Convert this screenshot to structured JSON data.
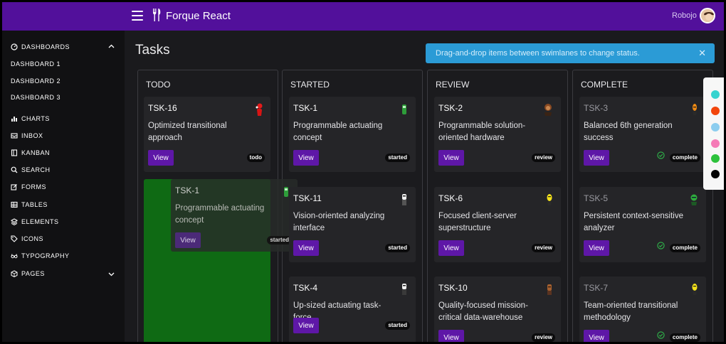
{
  "header": {
    "brand": "Forque React",
    "user": "Robojo"
  },
  "colors": {
    "primary": "#52109b",
    "button": "#5e17a7",
    "alert": "#2b9bd6",
    "drop_zone": "#0f6a14",
    "check": "#2fb84b"
  },
  "sidebar": {
    "dashboards": "DASHBOARDS",
    "dashboard_1": "DASHBOARD 1",
    "dashboard_2": "DASHBOARD 2",
    "dashboard_3": "DASHBOARD 3",
    "charts": "CHARTS",
    "inbox": "INBOX",
    "kanban": "KANBAN",
    "search": "SEARCH",
    "forms": "FORMS",
    "tables": "TABLES",
    "elements": "ELEMENTS",
    "icons": "ICONS",
    "typography": "TYPOGRAPHY",
    "pages": "PAGES"
  },
  "page": {
    "title": "Tasks",
    "alert": "Drag-and-drop items between swimlanes to change status."
  },
  "lanes": {
    "todo": "TODO",
    "started": "STARTED",
    "review": "REVIEW",
    "complete": "COMPLETE"
  },
  "button_label": "View",
  "cards": {
    "tsk16": {
      "id": "TSK-16",
      "desc": "Optimized transitional approach",
      "status": "todo"
    },
    "tsk1_ghost": {
      "id": "TSK-1",
      "desc": "Programmable actuating concept",
      "status": "started"
    },
    "tsk1": {
      "id": "TSK-1",
      "desc": "Programmable actuating concept",
      "status": "started"
    },
    "tsk11": {
      "id": "TSK-11",
      "desc": "Vision-oriented analyzing interface",
      "status": "started"
    },
    "tsk4": {
      "id": "TSK-4",
      "desc": "Up-sized actuating task-force",
      "status": "started"
    },
    "tsk2": {
      "id": "TSK-2",
      "desc": "Programmable solution-oriented hardware",
      "status": "review"
    },
    "tsk6": {
      "id": "TSK-6",
      "desc": "Focused client-server superstructure",
      "status": "review"
    },
    "tsk10": {
      "id": "TSK-10",
      "desc": "Quality-focused mission-critical data-warehouse",
      "status": "review"
    },
    "tsk3": {
      "id": "TSK-3",
      "desc": "Balanced 6th generation success",
      "status": "complete"
    },
    "tsk5": {
      "id": "TSK-5",
      "desc": "Persistent context-sensitive analyzer",
      "status": "complete"
    },
    "tsk7": {
      "id": "TSK-7",
      "desc": "Team-oriented transitional methodology",
      "status": "complete"
    }
  },
  "palette": [
    "#37d3cf",
    "#f2450c",
    "#8ccdef",
    "#f57ab7",
    "#2dc23c",
    "#050505"
  ]
}
